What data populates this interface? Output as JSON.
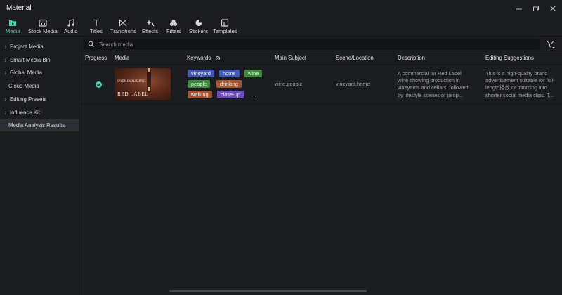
{
  "window": {
    "title": "Material"
  },
  "toolbar": {
    "items": [
      {
        "label": "Media",
        "icon": "media-folder-icon",
        "active": true
      },
      {
        "label": "Stock Media",
        "icon": "stock-media-icon"
      },
      {
        "label": "Audio",
        "icon": "music-note-icon"
      },
      {
        "label": "Titles",
        "icon": "text-t-icon"
      },
      {
        "label": "Transitions",
        "icon": "bowtie-transition-icon"
      },
      {
        "label": "Effects",
        "icon": "sparkle-effects-icon"
      },
      {
        "label": "Filters",
        "icon": "circles-filter-icon"
      },
      {
        "label": "Stickers",
        "icon": "sticker-icon"
      },
      {
        "label": "Templates",
        "icon": "template-icon"
      }
    ],
    "accent_color": "#3fd6b0"
  },
  "sidebar": {
    "items": [
      {
        "label": "Project Media",
        "expandable": true
      },
      {
        "label": "Smart Media Bin",
        "expandable": true
      },
      {
        "label": "Global Media",
        "expandable": true
      },
      {
        "label": "Cloud Media",
        "expandable": false
      },
      {
        "label": "Editing Presets",
        "expandable": true
      },
      {
        "label": "Influence Kit",
        "expandable": true
      },
      {
        "label": "Media Analysis Results",
        "expandable": false,
        "active": true
      }
    ]
  },
  "search": {
    "placeholder": "Search media"
  },
  "table": {
    "columns": {
      "progress": "Progress",
      "media": "Media",
      "keywords": "Keywords",
      "main_subject": "Main Subject",
      "scene_location": "Scene/Location",
      "description": "Description",
      "editing_suggestions": "Editing Suggestions"
    },
    "rows": [
      {
        "progress": "complete",
        "media": {
          "thumbnail_line1": "INTRODUCING",
          "thumbnail_line2": "RED LABEL"
        },
        "keywords": [
          {
            "text": "vineyard",
            "color": "#3d56b3"
          },
          {
            "text": "home",
            "color": "#3d56b3"
          },
          {
            "text": "wine",
            "color": "#3d8a3a"
          },
          {
            "text": "people",
            "color": "#3d8a3a"
          },
          {
            "text": "drinking",
            "color": "#a2552f"
          },
          {
            "text": "walking",
            "color": "#a2552f"
          },
          {
            "text": "close-up",
            "color": "#6d4bc4"
          }
        ],
        "keywords_more": "...",
        "main_subject": "wine,people",
        "scene_location": "vineyard,home",
        "description": {
          "line1": "A commercial for Red Label",
          "line2": "wine showing production in",
          "line3": "vineyards and cellars, followed",
          "line4": "by lifestyle scenes of peop..."
        },
        "editing_suggestions": {
          "line1": "This is a high-quality brand",
          "line2": "advertisement suitable for full-",
          "line3": "length播放 or trimming into",
          "line4": "shorter social media clips. T..."
        }
      }
    ]
  }
}
